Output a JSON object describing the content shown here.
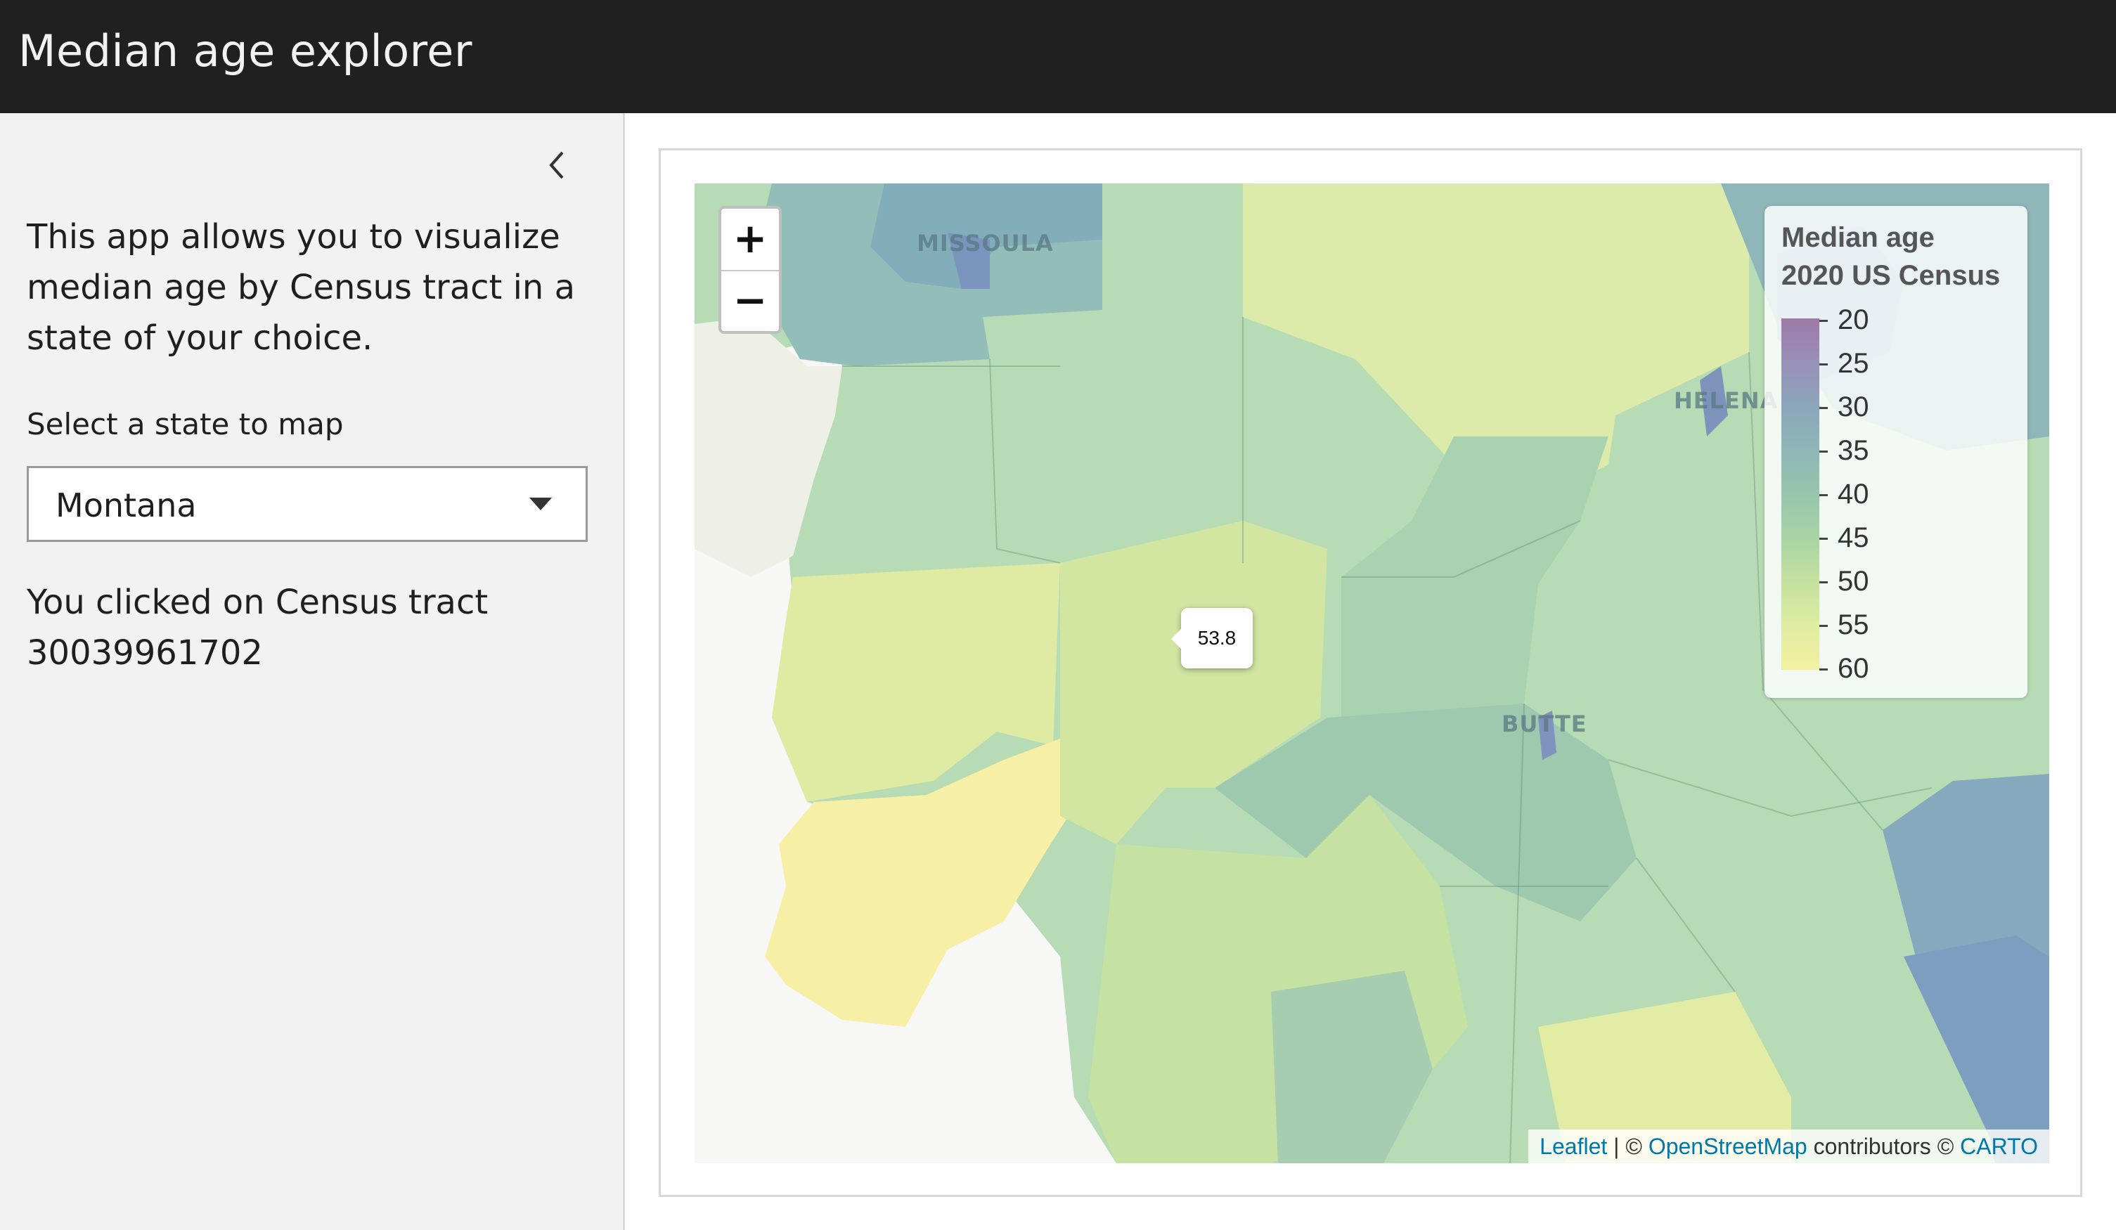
{
  "header": {
    "title": "Median age explorer"
  },
  "sidebar": {
    "intro": "This app allows you to visualize median age by Census tract in a state of your choice.",
    "select_label": "Select a state to map",
    "selected_state": "Montana",
    "clicked_prefix": "You clicked on Census tract",
    "clicked_tract": "30039961702"
  },
  "map": {
    "zoom_in": "+",
    "zoom_out": "−",
    "tooltip_value": "53.8",
    "cities": [
      "MISSOULA",
      "HELENA",
      "BUTTE"
    ],
    "legend": {
      "title_line1": "Median age",
      "title_line2": "2020 US Census",
      "ticks": [
        "20",
        "25",
        "30",
        "35",
        "40",
        "45",
        "50",
        "55",
        "60"
      ],
      "colors": [
        "#9b7ba6",
        "#9990b6",
        "#8ca6bb",
        "#8fb6b7",
        "#98c5ad",
        "#a8d4a5",
        "#c4e1a0",
        "#e0eca2",
        "#f2f0a0"
      ]
    },
    "attribution": {
      "leaflet": "Leaflet",
      "sep": "| ©",
      "osm": "OpenStreetMap",
      "contributors": "contributors ©",
      "carto": "CARTO"
    }
  }
}
